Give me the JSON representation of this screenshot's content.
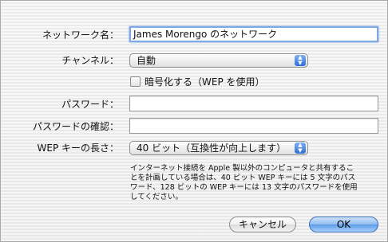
{
  "dialog": {
    "network_name_label": "ネットワーク名：",
    "network_name_value": "James Morengo のネットワーク",
    "channel_label": "チャンネル：",
    "channel_value": "自動",
    "encrypt_checkbox_label": "暗号化する（WEP を使用）",
    "password_label": "パスワード：",
    "password_value": "",
    "password_confirm_label": "パスワードの確認：",
    "password_confirm_value": "",
    "wep_key_length_label": "WEP キーの長さ：",
    "wep_key_length_value": "40 ビット（互換性が向上します）",
    "help_text": "インターネット接続を Apple 製以外のコンピュータと共有するこ\nとを計画している場合は、40 ビット WEP キーには 5 文字のパス\nワード、128 ビットの WEP キーには 13 文字のパスワードを使用\nしてください。",
    "cancel_button": "キャンセル",
    "ok_button": "OK"
  },
  "colors": {
    "accent": "#5d9be8",
    "focus_ring": "#7fa9e6",
    "background": "#f2f2f2"
  },
  "icons": {
    "popup_arrows": "up-down-arrows-icon",
    "checkbox": "checkbox-unchecked-icon"
  }
}
